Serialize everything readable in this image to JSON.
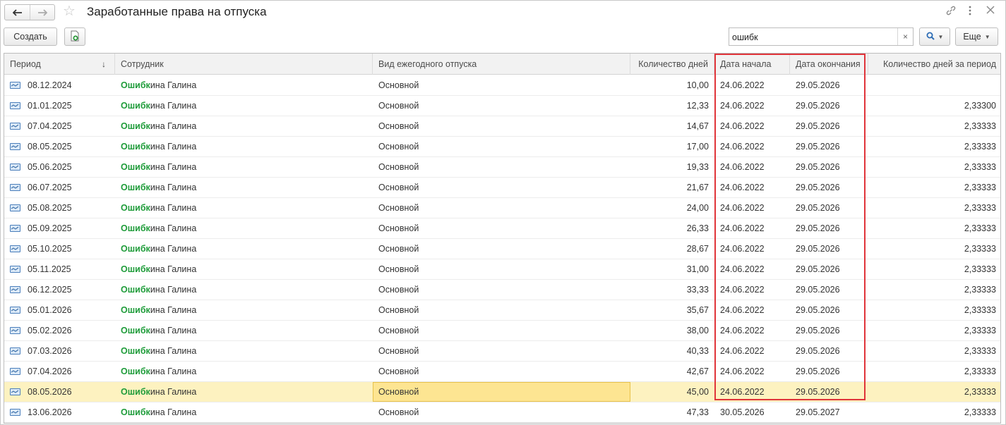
{
  "window": {
    "title": "Заработанные права на отпуска",
    "nav_back_icon": "arrow-left-icon",
    "nav_forward_icon": "arrow-right-icon",
    "favorite_icon": "star-icon",
    "link_icon": "link-icon",
    "menu_icon": "kebab-menu-icon",
    "close_icon": "close-icon"
  },
  "toolbar": {
    "create_label": "Создать",
    "copy_icon": "copy-document-icon",
    "search": {
      "value": "ошибк",
      "clear": "×"
    },
    "search_button_icon": "search-icon",
    "more_label": "Еще"
  },
  "table": {
    "columns": [
      {
        "key": "period",
        "label": "Период",
        "sort": "↓"
      },
      {
        "key": "employee",
        "label": "Сотрудник"
      },
      {
        "key": "vacation_type",
        "label": "Вид ежегодного отпуска"
      },
      {
        "key": "days",
        "label": "Количество дней"
      },
      {
        "key": "start",
        "label": "Дата начала"
      },
      {
        "key": "end",
        "label": "Дата окончания"
      },
      {
        "key": "days_period",
        "label": "Количество дней за период"
      }
    ],
    "rows": [
      {
        "period": "08.12.2024",
        "emp_match": "Ошибк",
        "emp_rest": "ина Галина",
        "type": "Основной",
        "days": "10,00",
        "start": "24.06.2022",
        "end": "29.05.2026",
        "days_period": ""
      },
      {
        "period": "01.01.2025",
        "emp_match": "Ошибк",
        "emp_rest": "ина Галина",
        "type": "Основной",
        "days": "12,33",
        "start": "24.06.2022",
        "end": "29.05.2026",
        "days_period": "2,33300"
      },
      {
        "period": "07.04.2025",
        "emp_match": "Ошибк",
        "emp_rest": "ина Галина",
        "type": "Основной",
        "days": "14,67",
        "start": "24.06.2022",
        "end": "29.05.2026",
        "days_period": "2,33333"
      },
      {
        "period": "08.05.2025",
        "emp_match": "Ошибк",
        "emp_rest": "ина Галина",
        "type": "Основной",
        "days": "17,00",
        "start": "24.06.2022",
        "end": "29.05.2026",
        "days_period": "2,33333"
      },
      {
        "period": "05.06.2025",
        "emp_match": "Ошибк",
        "emp_rest": "ина Галина",
        "type": "Основной",
        "days": "19,33",
        "start": "24.06.2022",
        "end": "29.05.2026",
        "days_period": "2,33333"
      },
      {
        "period": "06.07.2025",
        "emp_match": "Ошибк",
        "emp_rest": "ина Галина",
        "type": "Основной",
        "days": "21,67",
        "start": "24.06.2022",
        "end": "29.05.2026",
        "days_period": "2,33333"
      },
      {
        "period": "05.08.2025",
        "emp_match": "Ошибк",
        "emp_rest": "ина Галина",
        "type": "Основной",
        "days": "24,00",
        "start": "24.06.2022",
        "end": "29.05.2026",
        "days_period": "2,33333"
      },
      {
        "period": "05.09.2025",
        "emp_match": "Ошибк",
        "emp_rest": "ина Галина",
        "type": "Основной",
        "days": "26,33",
        "start": "24.06.2022",
        "end": "29.05.2026",
        "days_period": "2,33333"
      },
      {
        "period": "05.10.2025",
        "emp_match": "Ошибк",
        "emp_rest": "ина Галина",
        "type": "Основной",
        "days": "28,67",
        "start": "24.06.2022",
        "end": "29.05.2026",
        "days_period": "2,33333"
      },
      {
        "period": "05.11.2025",
        "emp_match": "Ошибк",
        "emp_rest": "ина Галина",
        "type": "Основной",
        "days": "31,00",
        "start": "24.06.2022",
        "end": "29.05.2026",
        "days_period": "2,33333"
      },
      {
        "period": "06.12.2025",
        "emp_match": "Ошибк",
        "emp_rest": "ина Галина",
        "type": "Основной",
        "days": "33,33",
        "start": "24.06.2022",
        "end": "29.05.2026",
        "days_period": "2,33333"
      },
      {
        "period": "05.01.2026",
        "emp_match": "Ошибк",
        "emp_rest": "ина Галина",
        "type": "Основной",
        "days": "35,67",
        "start": "24.06.2022",
        "end": "29.05.2026",
        "days_period": "2,33333"
      },
      {
        "period": "05.02.2026",
        "emp_match": "Ошибк",
        "emp_rest": "ина Галина",
        "type": "Основной",
        "days": "38,00",
        "start": "24.06.2022",
        "end": "29.05.2026",
        "days_period": "2,33333"
      },
      {
        "period": "07.03.2026",
        "emp_match": "Ошибк",
        "emp_rest": "ина Галина",
        "type": "Основной",
        "days": "40,33",
        "start": "24.06.2022",
        "end": "29.05.2026",
        "days_period": "2,33333"
      },
      {
        "period": "07.04.2026",
        "emp_match": "Ошибк",
        "emp_rest": "ина Галина",
        "type": "Основной",
        "days": "42,67",
        "start": "24.06.2022",
        "end": "29.05.2026",
        "days_period": "2,33333"
      },
      {
        "period": "08.05.2026",
        "emp_match": "Ошибк",
        "emp_rest": "ина Галина",
        "type": "Основной",
        "days": "45,00",
        "start": "24.06.2022",
        "end": "29.05.2026",
        "days_period": "2,33333",
        "selected": true
      },
      {
        "period": "13.06.2026",
        "emp_match": "Ошибк",
        "emp_rest": "ина Галина",
        "type": "Основной",
        "days": "47,33",
        "start": "30.05.2026",
        "end": "29.05.2027",
        "days_period": "2,33333"
      }
    ]
  },
  "colors": {
    "match_highlight": "#1f9c3a",
    "selected_row": "#fdf2c0",
    "focused_cell": "#fde592",
    "annotation_frame": "#e0343a"
  }
}
